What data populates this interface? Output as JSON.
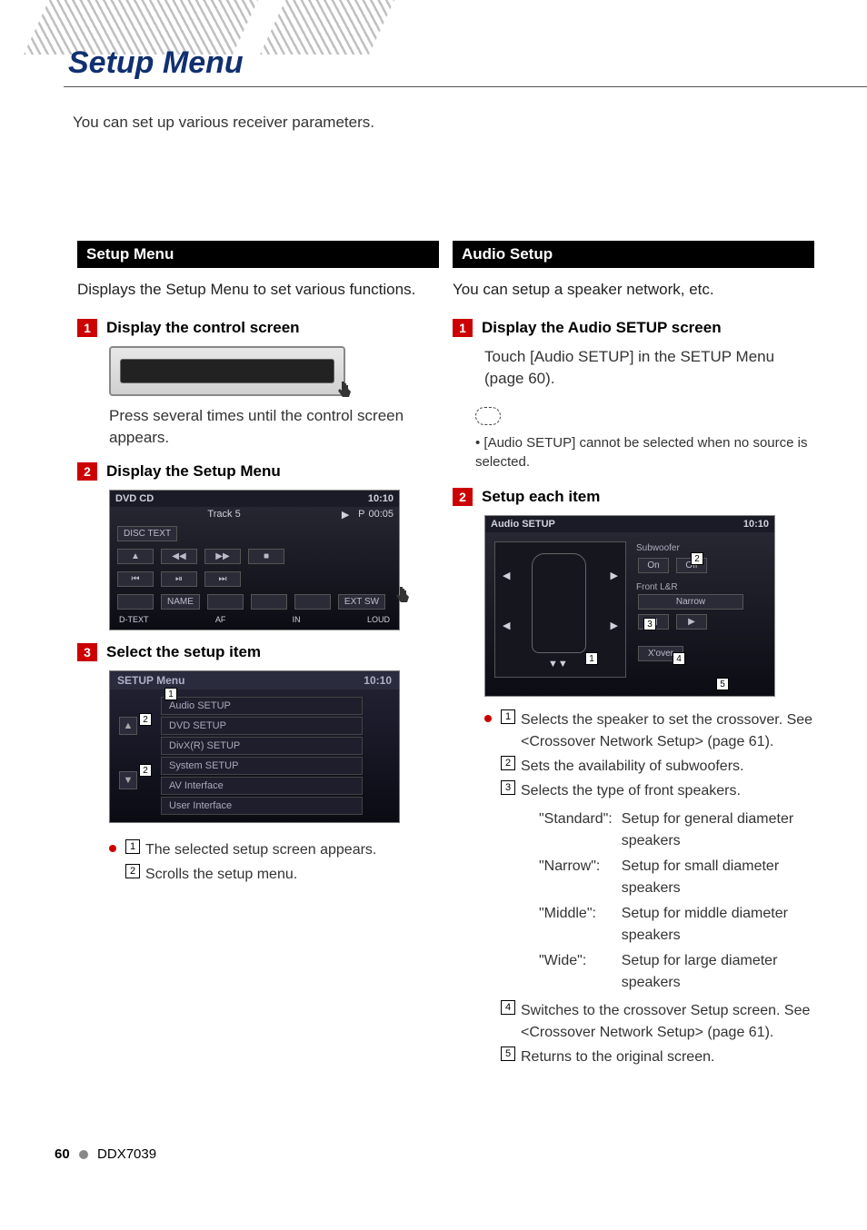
{
  "page_title": "Setup Menu",
  "intro": "You can set up various receiver parameters.",
  "left": {
    "section_title": "Setup Menu",
    "desc": "Displays the Setup Menu to set various functions.",
    "step1": {
      "num": "1",
      "label": "Display the control screen",
      "body": "Press several times until the control screen appears."
    },
    "step2": {
      "num": "2",
      "label": "Display the Setup Menu"
    },
    "dvd_screen": {
      "title": "DVD CD",
      "time": "10:10",
      "track": "Track 5",
      "p": "P",
      "elapsed": "00:05",
      "disc_text": "DISC TEXT",
      "row_btns1": [
        "▲",
        "◀◀",
        "▶▶",
        "■"
      ],
      "row_btns2": [
        "⏮",
        "⏯",
        "⏭"
      ],
      "bottom": [
        "",
        "NAME",
        "",
        "",
        "",
        "EXT SW"
      ],
      "footer": [
        "D-TEXT",
        "AF",
        "IN",
        "LOUD"
      ]
    },
    "step3": {
      "num": "3",
      "label": "Select the setup item"
    },
    "setup_menu_screen": {
      "title": "SETUP Menu",
      "time": "10:10",
      "items": [
        "Audio SETUP",
        "DVD SETUP",
        "DivX(R) SETUP",
        "System SETUP",
        "AV Interface",
        "User Interface"
      ]
    },
    "callouts": [
      {
        "n": "1",
        "text": "The selected setup screen appears."
      },
      {
        "n": "2",
        "text": "Scrolls the setup menu."
      }
    ]
  },
  "right": {
    "section_title": "Audio Setup",
    "desc": "You can setup a speaker network, etc.",
    "step1": {
      "num": "1",
      "label": "Display the Audio SETUP screen",
      "body": "Touch [Audio SETUP] in the SETUP Menu (page 60)."
    },
    "note": "[Audio SETUP] cannot be selected when no source is selected.",
    "step2": {
      "num": "2",
      "label": "Setup each item"
    },
    "audio_screen": {
      "title": "Audio SETUP",
      "time": "10:10",
      "labels": {
        "sub": "Subwoofer",
        "on": "On",
        "off": "Off",
        "front": "Front L&R",
        "narrow": "Narrow",
        "xover": "X'over"
      }
    },
    "callouts": [
      {
        "n": "1",
        "text": "Selects the speaker to set the crossover. See <Crossover Network Setup> (page 61)."
      },
      {
        "n": "2",
        "text": "Sets the availability of subwoofers."
      },
      {
        "n": "3",
        "text": "Selects the type of front speakers."
      },
      {
        "n": "4",
        "text": "Switches to the crossover Setup screen. See <Crossover Network Setup> (page 61)."
      },
      {
        "n": "5",
        "text": "Returns to the original screen."
      }
    ],
    "speaker_types": [
      {
        "k": "\"Standard\":",
        "v": "Setup for general diameter speakers"
      },
      {
        "k": "\"Narrow\":",
        "v": "Setup for small diameter speakers"
      },
      {
        "k": "\"Middle\":",
        "v": "Setup for middle diameter speakers"
      },
      {
        "k": "\"Wide\":",
        "v": "Setup for large diameter speakers"
      }
    ]
  },
  "footer": {
    "page": "60",
    "model": "DDX7039"
  }
}
